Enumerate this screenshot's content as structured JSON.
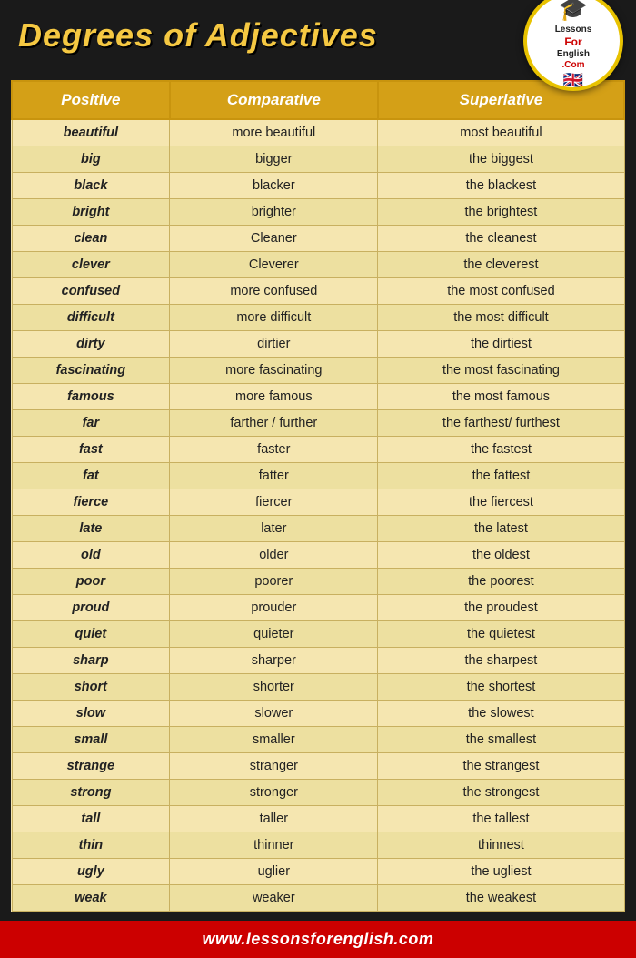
{
  "header": {
    "title": "Degrees of Adjectives",
    "logo": {
      "line1": "Lessons",
      "line2": "For",
      "line3": "English",
      "line4": ".Com"
    }
  },
  "table": {
    "columns": [
      "Positive",
      "Comparative",
      "Superlative"
    ],
    "rows": [
      [
        "beautiful",
        "more beautiful",
        "most beautiful"
      ],
      [
        "big",
        "bigger",
        "the biggest"
      ],
      [
        "black",
        "blacker",
        "the blackest"
      ],
      [
        "bright",
        "brighter",
        "the brightest"
      ],
      [
        "clean",
        "Cleaner",
        "the cleanest"
      ],
      [
        "clever",
        "Cleverer",
        "the cleverest"
      ],
      [
        "confused",
        "more confused",
        "the most confused"
      ],
      [
        "difficult",
        "more difficult",
        "the most difficult"
      ],
      [
        "dirty",
        "dirtier",
        "the dirtiest"
      ],
      [
        "fascinating",
        "more fascinating",
        "the most fascinating"
      ],
      [
        "famous",
        "more famous",
        "the most famous"
      ],
      [
        "far",
        "farther / further",
        "the farthest/ furthest"
      ],
      [
        "fast",
        "faster",
        "the fastest"
      ],
      [
        "fat",
        "fatter",
        "the fattest"
      ],
      [
        "fierce",
        "fiercer",
        "the fiercest"
      ],
      [
        "late",
        "later",
        "the latest"
      ],
      [
        "old",
        "older",
        "the oldest"
      ],
      [
        "poor",
        "poorer",
        "the poorest"
      ],
      [
        "proud",
        "prouder",
        "the proudest"
      ],
      [
        "quiet",
        "quieter",
        "the quietest"
      ],
      [
        "sharp",
        "sharper",
        "the sharpest"
      ],
      [
        "short",
        "shorter",
        "the shortest"
      ],
      [
        "slow",
        "slower",
        "the slowest"
      ],
      [
        "small",
        "smaller",
        "the smallest"
      ],
      [
        "strange",
        "stranger",
        "the strangest"
      ],
      [
        "strong",
        "stronger",
        "the strongest"
      ],
      [
        "tall",
        "taller",
        "the tallest"
      ],
      [
        "thin",
        "thinner",
        "thinnest"
      ],
      [
        "ugly",
        "uglier",
        "the ugliest"
      ],
      [
        "weak",
        "weaker",
        "the weakest"
      ]
    ]
  },
  "footer": {
    "url": "www.lessonsforenglish.com"
  }
}
